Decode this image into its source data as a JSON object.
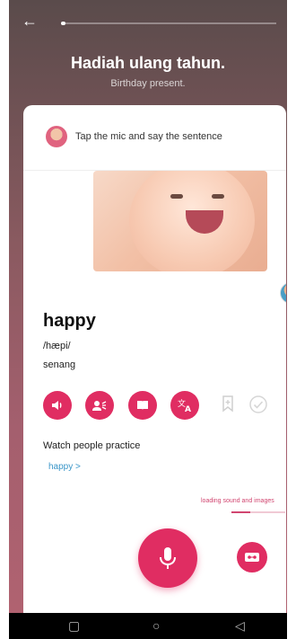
{
  "header": {
    "back_icon": "arrow-left-icon",
    "progress": 0.02
  },
  "lesson": {
    "title": "Hadiah ulang tahun.",
    "subtitle": "Birthday present."
  },
  "instruction": {
    "text": "Tap the mic and say the sentence"
  },
  "word": {
    "text": "happy",
    "phonetic": "/hæpi/",
    "translation": "senang"
  },
  "actions": {
    "sound_icon": "speaker-icon",
    "record_icon": "record-icon",
    "book_icon": "book-icon",
    "translate_icon": "translate-icon",
    "bookmark_icon": "bookmark-icon",
    "check_icon": "check-icon"
  },
  "watch": {
    "label": "Watch people practice",
    "link": "happy >"
  },
  "loading": {
    "text": "loading sound and images",
    "progress": 0.35
  },
  "nav": {
    "square_icon": "▢",
    "circle_icon": "○",
    "back_icon": "◁"
  },
  "colors": {
    "accent": "#e02d62"
  }
}
